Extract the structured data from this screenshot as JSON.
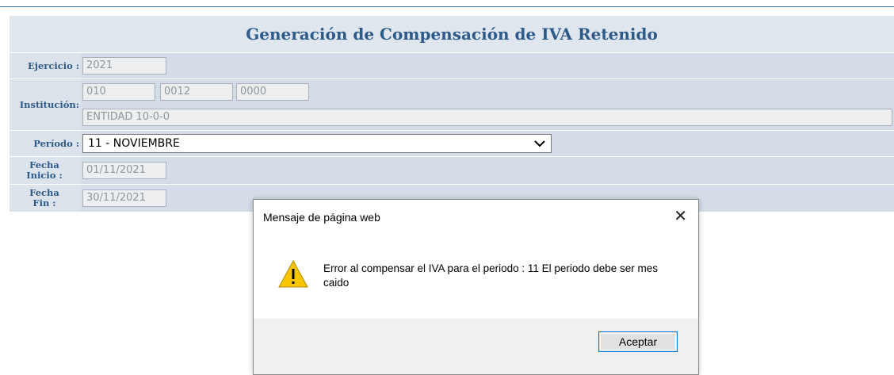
{
  "page": {
    "title": "Generación de Compensación de IVA Retenido"
  },
  "form": {
    "ejercicio": {
      "label": "Ejercicio :",
      "value": "2021"
    },
    "institucion": {
      "label": "Institución:",
      "code1": "010",
      "code2": "0012",
      "code3": "0000",
      "name": "ENTIDAD 10-0-0"
    },
    "periodo": {
      "label": "Período :",
      "selected": "11 - NOVIEMBRE"
    },
    "fecha_inicio": {
      "label_line1": "Fecha",
      "label_line2": "Inicio :",
      "value": "01/11/2021"
    },
    "fecha_fin": {
      "label_line1": "Fecha",
      "label_line2": "Fin :",
      "value": "30/11/2021"
    }
  },
  "dialog": {
    "title": "Mensaje de página web",
    "close_glyph": "✕",
    "icon": "warning-icon",
    "message": "Error al compensar el IVA para el periodo : 11  El periodo debe ser mes caido",
    "button_label": "Aceptar"
  },
  "colors": {
    "accent": "#2e5a8a",
    "panel": "#d4dde8",
    "warning": "#f7c600"
  }
}
